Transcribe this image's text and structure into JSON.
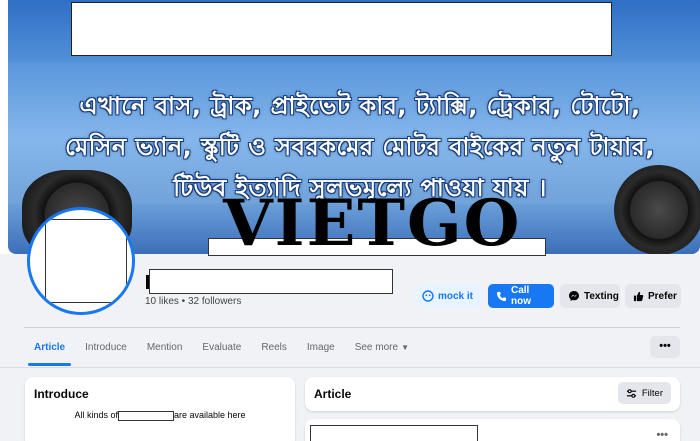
{
  "cover": {
    "line1": "এখানে বাস, ট্রাক, প্রাইভেট কার, ট্যাক্সি, ট্রেকার, টোটো,",
    "line2": "মেসিন ভ্যান, স্কুটি ও সবরকমের মোটর বাইকের নতুন টায়ার,",
    "line3": "টিউব ইত্যাদি সুলভমূল্যে পাওয়া যায় ।"
  },
  "watermark": "VIETGO",
  "profile": {
    "stats": "10 likes • 32 followers"
  },
  "actions": {
    "mock_label": "mock it",
    "call_label": "Call now",
    "texting_label": "Texting",
    "prefer_label": "Prefer"
  },
  "tabs": [
    {
      "label": "Article"
    },
    {
      "label": "Introduce"
    },
    {
      "label": "Mention"
    },
    {
      "label": "Evaluate"
    },
    {
      "label": "Reels"
    },
    {
      "label": "Image"
    },
    {
      "label": "See more"
    }
  ],
  "more_button": "•••",
  "intro": {
    "title": "Introduce",
    "text_before": "All kinds of",
    "text_after": "are available here"
  },
  "article": {
    "title": "Article",
    "filter_label": "Filter"
  },
  "post": {
    "more": "•••"
  },
  "colors": {
    "accent": "#1877f2",
    "background": "#f0f2f5"
  }
}
